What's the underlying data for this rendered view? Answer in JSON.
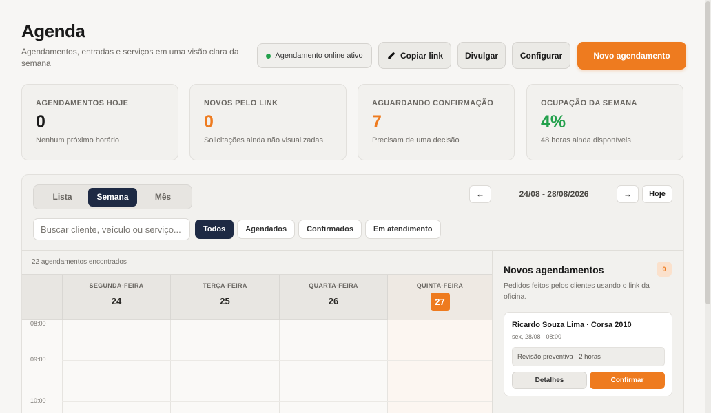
{
  "header": {
    "title": "Agenda",
    "subtitle": "Agendamentos, entradas e serviços em uma visão clara da semana",
    "online_status": "Agendamento online ativo",
    "copy_link": "Copiar link",
    "divulgar": "Divulgar",
    "configurar": "Configurar",
    "novo_agendamento": "Novo agendamento"
  },
  "colors": {
    "accent": "#ee7b1f",
    "navy": "#1e2a44",
    "success": "#22a04b"
  },
  "stats": [
    {
      "label": "AGENDAMENTOS HOJE",
      "value": "0",
      "desc": "Nenhum próximo horário",
      "color": "#1a1a1a"
    },
    {
      "label": "NOVOS PELO LINK",
      "value": "0",
      "desc": "Solicitações ainda não visualizadas",
      "color": "#ee7b1f"
    },
    {
      "label": "AGUARDANDO CONFIRMAÇÃO",
      "value": "7",
      "desc": "Precisam de uma decisão",
      "color": "#ee7b1f"
    },
    {
      "label": "OCUPAÇÃO DA SEMANA",
      "value": "4%",
      "desc": "48 horas ainda disponíveis",
      "color": "#22a04b"
    }
  ],
  "view_tabs": [
    "Lista",
    "Semana",
    "Mês"
  ],
  "active_view": "Semana",
  "date_nav": {
    "prev": "←",
    "range": "24/08 - 28/08/2026",
    "next": "→",
    "today": "Hoje"
  },
  "search": {
    "placeholder": "Buscar cliente, veículo ou serviço..."
  },
  "filters": [
    "Todos",
    "Agendados",
    "Confirmados",
    "Em atendimento"
  ],
  "results_count": "22 agendamentos encontrados",
  "calendar": {
    "days": [
      {
        "name": "SEGUNDA-FEIRA",
        "num": "24"
      },
      {
        "name": "TERÇA-FEIRA",
        "num": "25"
      },
      {
        "name": "QUARTA-FEIRA",
        "num": "26"
      },
      {
        "name": "QUINTA-FEIRA",
        "num": "27"
      }
    ],
    "times": [
      "08:00",
      "09:00",
      "10:00"
    ]
  },
  "sidebar": {
    "title": "Novos agendamentos",
    "badge": "0",
    "desc": "Pedidos feitos pelos clientes usando o link da oficina.",
    "request": {
      "name": "Ricardo Souza Lima · Corsa 2010",
      "time": "sex, 28/08 · 08:00",
      "service": "Revisão preventiva · 2 horas",
      "details": "Detalhes",
      "confirm": "Confirmar"
    }
  }
}
